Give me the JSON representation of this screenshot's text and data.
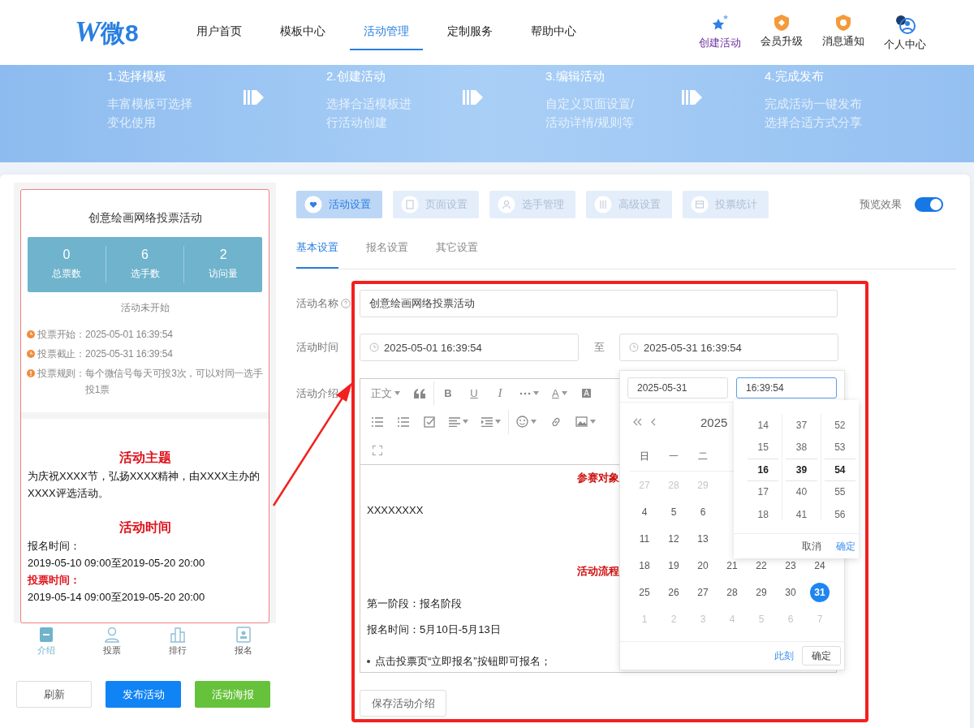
{
  "header": {
    "logo": {
      "mark": "W",
      "text": "微8"
    },
    "nav": [
      {
        "label": "用户首页",
        "selected": false
      },
      {
        "label": "模板中心",
        "selected": false
      },
      {
        "label": "活动管理",
        "selected": true
      },
      {
        "label": "定制服务",
        "selected": false
      },
      {
        "label": "帮助中心",
        "selected": false
      }
    ],
    "actions": [
      {
        "kind": "create",
        "label": "创建活动"
      },
      {
        "kind": "vip",
        "label": "会员升级"
      },
      {
        "kind": "notice",
        "label": "消息通知"
      },
      {
        "kind": "profile",
        "label": "个人中心"
      }
    ]
  },
  "banner": {
    "steps": [
      {
        "title": "1.选择模板",
        "lines": [
          "丰富模板可选择",
          "变化使用"
        ]
      },
      {
        "title": "2.创建活动",
        "lines": [
          "选择合适模板进",
          "行活动创建"
        ]
      },
      {
        "title": "3.编辑活动",
        "lines": [
          "自定义页面设置/",
          "活动详情/规则等"
        ]
      },
      {
        "title": "4.完成发布",
        "lines": [
          "完成活动一键发布",
          "选择合适方式分享"
        ]
      }
    ]
  },
  "preview": {
    "title": "创意绘画网络投票活动",
    "stats": [
      {
        "value": "0",
        "label": "总票数"
      },
      {
        "value": "6",
        "label": "选手数"
      },
      {
        "value": "2",
        "label": "访问量"
      }
    ],
    "status": "活动未开始",
    "info": [
      {
        "kind": "clock",
        "label": "投票开始：",
        "value": "2025-05-01 16:39:54"
      },
      {
        "kind": "clock",
        "label": "投票截止：",
        "value": "2025-05-31 16:39:54"
      },
      {
        "kind": "alert",
        "label": "投票规则：",
        "value": "每个微信号每天可投3次，可以对同一选手投1票"
      }
    ],
    "content": [
      {
        "kind": "heading",
        "text": "活动主题"
      },
      {
        "kind": "para",
        "text": "为庆祝XXXX节，弘扬XXXX精神，由XXXX主办的XXXX评选活动。"
      },
      {
        "kind": "heading",
        "text": "活动时间"
      },
      {
        "kind": "para",
        "text": "报名时间："
      },
      {
        "kind": "para",
        "text": "2019-05-10 09:00至2019-05-20 20:00"
      },
      {
        "kind": "label",
        "text": "投票时间："
      },
      {
        "kind": "para",
        "text": "2019-05-14 09:00至2019-05-20 20:00"
      }
    ],
    "tabbar": [
      {
        "kind": "intro",
        "label": "介绍",
        "selected": true
      },
      {
        "kind": "vote",
        "label": "投票",
        "selected": false
      },
      {
        "kind": "rank",
        "label": "排行",
        "selected": false
      },
      {
        "kind": "signup",
        "label": "报名",
        "selected": false
      }
    ]
  },
  "buttons": [
    {
      "kind": "plain",
      "label": "刷新"
    },
    {
      "kind": "primary",
      "label": "发布活动"
    },
    {
      "kind": "success",
      "label": "活动海报"
    }
  ],
  "settings": {
    "tabs": [
      {
        "kind": "heart",
        "label": "活动设置",
        "selected": true
      },
      {
        "kind": "page",
        "label": "页面设置",
        "selected": false
      },
      {
        "kind": "user",
        "label": "选手管理",
        "selected": false
      },
      {
        "kind": "tools",
        "label": "高级设置",
        "selected": false
      },
      {
        "kind": "stats",
        "label": "投票统计",
        "selected": false
      }
    ],
    "preview_toggle": {
      "label": "预览效果",
      "on": true
    },
    "subtabs": [
      {
        "label": "基本设置",
        "selected": true
      },
      {
        "label": "报名设置",
        "selected": false
      },
      {
        "label": "其它设置",
        "selected": false
      }
    ],
    "form": {
      "name_label": "活动名称",
      "name_value": "创意绘画网络投票活动",
      "time_label": "活动时间",
      "start": "2025-05-01 16:39:54",
      "separator": "至",
      "end": "2025-05-31 16:39:54",
      "intro_label": "活动介绍",
      "save": "保存活动介绍"
    },
    "editor": {
      "toolbar": [
        [
          {
            "kind": "select",
            "label": "正文"
          },
          {
            "kind": "quote"
          },
          {
            "kind": "sep"
          },
          {
            "kind": "bold",
            "label": "B"
          },
          {
            "kind": "underline",
            "label": "U"
          },
          {
            "kind": "italic",
            "label": "I"
          },
          {
            "kind": "more"
          },
          {
            "kind": "color",
            "label": "A"
          },
          {
            "kind": "bgcolor",
            "label": "A"
          }
        ],
        [
          {
            "kind": "bullets"
          },
          {
            "kind": "numbers"
          },
          {
            "kind": "todo"
          },
          {
            "kind": "align"
          },
          {
            "kind": "indent"
          },
          {
            "kind": "sep"
          },
          {
            "kind": "emoji"
          },
          {
            "kind": "link"
          },
          {
            "kind": "image"
          }
        ],
        [
          {
            "kind": "fullscreen"
          }
        ]
      ],
      "content": [
        {
          "kind": "heading",
          "text": "参赛对象"
        },
        {
          "kind": "para",
          "text": "XXXXXXXX"
        },
        {
          "kind": "heading",
          "text": "活动流程"
        },
        {
          "kind": "para",
          "text": "第一阶段：报名阶段"
        },
        {
          "kind": "para",
          "text": "报名时间：5月10日-5月13日"
        },
        {
          "kind": "bullet",
          "text": "点击投票页“立即报名”按钮即可报名；"
        }
      ]
    }
  },
  "date_picker": {
    "date": "2025-05-31",
    "time": "16:39:54",
    "title": "2025",
    "weekdays": [
      "日",
      "一",
      "二"
    ],
    "rows": [
      [
        {
          "day": "27",
          "muted": true,
          "selected": false
        },
        {
          "day": "28",
          "muted": true,
          "selected": false
        },
        {
          "day": "29",
          "muted": true,
          "selected": false
        }
      ],
      [
        {
          "day": "4",
          "muted": false,
          "selected": false
        },
        {
          "day": "5",
          "muted": false,
          "selected": false
        },
        {
          "day": "6",
          "muted": false,
          "selected": false
        }
      ],
      [
        {
          "day": "11",
          "muted": false,
          "selected": false
        },
        {
          "day": "12",
          "muted": false,
          "selected": false
        },
        {
          "day": "13",
          "muted": false,
          "selected": false
        }
      ],
      [
        {
          "day": "18",
          "muted": false,
          "selected": false
        },
        {
          "day": "19",
          "muted": false,
          "selected": false
        },
        {
          "day": "20",
          "muted": false,
          "selected": false
        },
        {
          "day": "21",
          "muted": false,
          "selected": false
        },
        {
          "day": "22",
          "muted": false,
          "selected": false
        },
        {
          "day": "23",
          "muted": false,
          "selected": false
        },
        {
          "day": "24",
          "muted": false,
          "selected": false
        }
      ],
      [
        {
          "day": "25",
          "muted": false,
          "selected": false
        },
        {
          "day": "26",
          "muted": false,
          "selected": false
        },
        {
          "day": "27",
          "muted": false,
          "selected": false
        },
        {
          "day": "28",
          "muted": false,
          "selected": false
        },
        {
          "day": "29",
          "muted": false,
          "selected": false
        },
        {
          "day": "30",
          "muted": false,
          "selected": false
        },
        {
          "day": "31",
          "muted": false,
          "selected": true
        }
      ],
      [
        {
          "day": "1",
          "muted": true,
          "selected": false
        },
        {
          "day": "2",
          "muted": true,
          "selected": false
        },
        {
          "day": "3",
          "muted": true,
          "selected": false
        },
        {
          "day": "4",
          "muted": true,
          "selected": false
        },
        {
          "day": "5",
          "muted": true,
          "selected": false
        },
        {
          "day": "6",
          "muted": true,
          "selected": false
        },
        {
          "day": "7",
          "muted": true,
          "selected": false
        }
      ]
    ],
    "now": "此刻",
    "ok": "确定",
    "time_panel": {
      "columns": [
        [
          {
            "v": "14",
            "selected": false
          },
          {
            "v": "15",
            "selected": false
          },
          {
            "v": "16",
            "selected": true
          },
          {
            "v": "17",
            "selected": false
          },
          {
            "v": "18",
            "selected": false
          }
        ],
        [
          {
            "v": "37",
            "selected": false
          },
          {
            "v": "38",
            "selected": false
          },
          {
            "v": "39",
            "selected": true
          },
          {
            "v": "40",
            "selected": false
          },
          {
            "v": "41",
            "selected": false
          }
        ],
        [
          {
            "v": "52",
            "selected": false
          },
          {
            "v": "53",
            "selected": false
          },
          {
            "v": "54",
            "selected": true
          },
          {
            "v": "55",
            "selected": false
          },
          {
            "v": "56",
            "selected": false
          }
        ]
      ],
      "cancel": "取消",
      "ok": "确定"
    }
  }
}
